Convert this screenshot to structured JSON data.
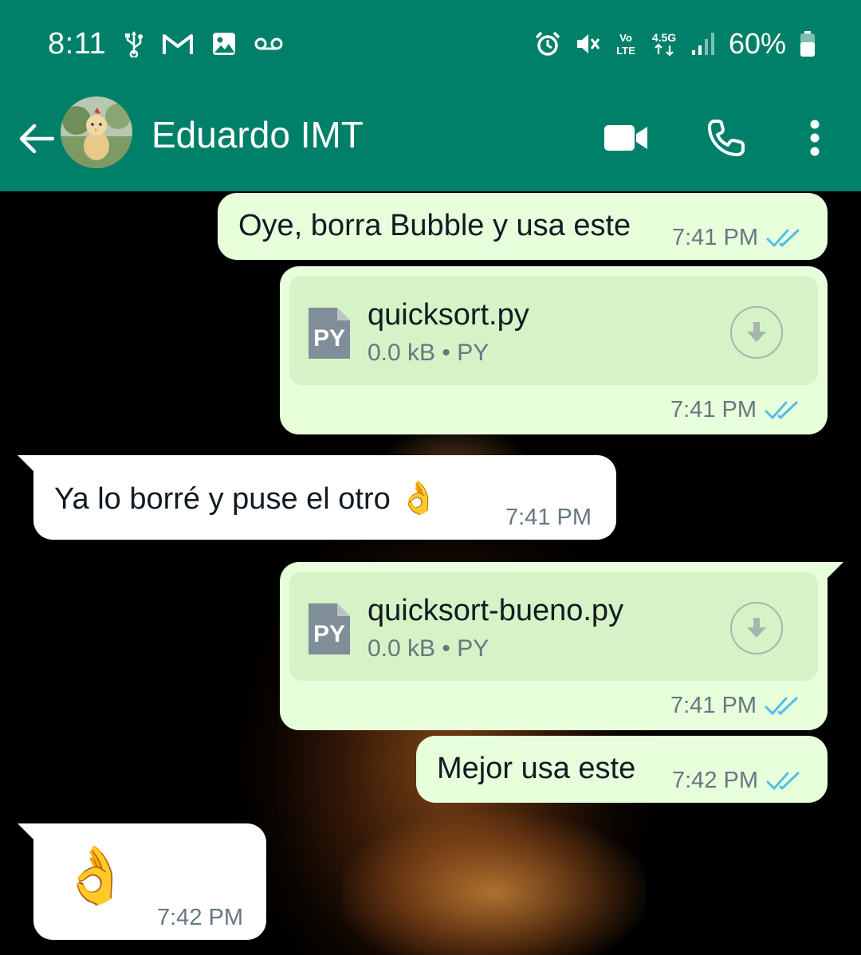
{
  "status_bar": {
    "time": "8:11",
    "battery": "60%",
    "network": "4.5G",
    "volte": "Vo LTE",
    "left_icons": [
      "usb-icon",
      "gmail-icon",
      "gallery-icon",
      "voicemail-icon"
    ],
    "right_icons": [
      "alarm-icon",
      "mute-icon",
      "volte-icon",
      "network-icon",
      "signal-icon",
      "battery-icon"
    ]
  },
  "header": {
    "contact_name": "Eduardo IMT",
    "icons": [
      "back-arrow-icon",
      "video-call-icon",
      "voice-call-icon",
      "more-vert-icon"
    ],
    "bg_color": "#008069"
  },
  "messages": [
    {
      "direction": "out",
      "type": "text",
      "text": "Oye, borra Bubble y usa este",
      "time": "7:41 PM",
      "status": "read"
    },
    {
      "direction": "out",
      "type": "document",
      "file_name": "quicksort.py",
      "file_size": "0.0 kB",
      "file_type": "PY",
      "file_icon_label": "PY",
      "time": "7:41 PM",
      "status": "read"
    },
    {
      "direction": "in",
      "type": "text",
      "text": "Ya lo borré y puse el otro",
      "emoji": "👌",
      "time": "7:41 PM"
    },
    {
      "direction": "out",
      "type": "document",
      "file_name": "quicksort-bueno.py",
      "file_size": "0.0 kB",
      "file_type": "PY",
      "file_icon_label": "PY",
      "time": "7:41 PM",
      "status": "read"
    },
    {
      "direction": "out",
      "type": "text",
      "text": "Mejor usa este",
      "time": "7:42 PM",
      "status": "read"
    },
    {
      "direction": "in",
      "type": "emoji",
      "emoji": "👌",
      "time": "7:42 PM"
    }
  ],
  "colors": {
    "outgoing_bubble": "#e7ffdb",
    "incoming_bubble": "#ffffff",
    "read_ticks": "#53bdeb",
    "time_text": "#667781"
  }
}
